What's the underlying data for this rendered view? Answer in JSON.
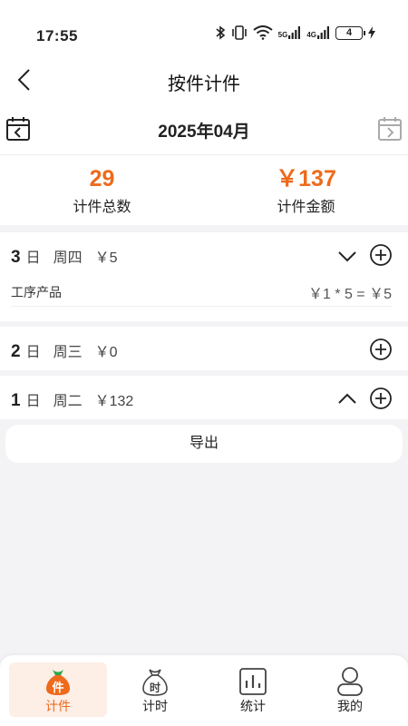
{
  "status": {
    "time": "17:55",
    "net5g": "5G",
    "net4g": "4G",
    "battery": "4"
  },
  "nav": {
    "title": "按件计件"
  },
  "month": {
    "label": "2025年04月"
  },
  "summary": {
    "count_value": "29",
    "count_label": "计件总数",
    "amount_value": "￥137",
    "amount_label": "计件金额"
  },
  "days": [
    {
      "num": "3",
      "unit": "日",
      "weekday": "周四",
      "amount": "￥5",
      "expanded": true,
      "items": [
        {
          "name": "工序产品",
          "formula": "￥1 * 5 =  ￥5"
        }
      ]
    },
    {
      "num": "2",
      "unit": "日",
      "weekday": "周三",
      "amount": "￥0",
      "expanded": false
    },
    {
      "num": "1",
      "unit": "日",
      "weekday": "周二",
      "amount": "￥132",
      "expanded": true
    }
  ],
  "export": {
    "label": "导出"
  },
  "tabs": [
    {
      "label": "计件",
      "icon": "piecework-bag-icon",
      "glyph": "件",
      "active": true
    },
    {
      "label": "计时",
      "icon": "timing-bag-icon",
      "glyph": "时",
      "active": false
    },
    {
      "label": "统计",
      "icon": "statistics-chart-icon",
      "active": false
    },
    {
      "label": "我的",
      "icon": "profile-person-icon",
      "active": false
    }
  ],
  "colors": {
    "accent": "#ee6a1c",
    "accent_bg": "#fdeee6",
    "page_bg": "#f3f3f5"
  }
}
